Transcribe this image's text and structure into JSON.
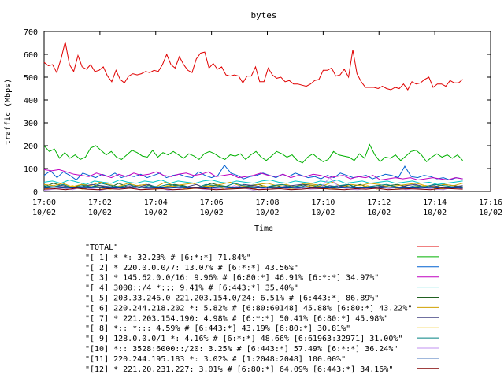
{
  "chart_data": {
    "type": "line",
    "title": "bytes",
    "xlabel": "Time",
    "ylabel": "traffic (Mbps)",
    "ylim": [
      0,
      700
    ],
    "yticks": [
      0,
      100,
      200,
      300,
      400,
      500,
      600,
      700
    ],
    "xlim": [
      "17:00",
      "17:16"
    ],
    "xticks": [
      {
        "time": "17:00",
        "date": "10/02"
      },
      {
        "time": "17:02",
        "date": "10/02"
      },
      {
        "time": "17:04",
        "date": "10/02"
      },
      {
        "time": "17:06",
        "date": "10/02"
      },
      {
        "time": "17:08",
        "date": "10/02"
      },
      {
        "time": "17:10",
        "date": "10/02"
      },
      {
        "time": "17:12",
        "date": "10/02"
      },
      {
        "time": "17:14",
        "date": "10/02"
      },
      {
        "time": "17:16",
        "date": "10/02"
      }
    ],
    "grid": false,
    "legend_position": "bottom",
    "x_minutes": [
      0.0,
      0.25,
      0.5,
      0.75,
      1.0,
      1.25,
      1.5,
      1.75,
      2.0,
      2.25,
      2.5,
      2.75,
      3.0,
      3.25,
      3.5,
      3.75,
      4.0,
      4.25,
      4.5,
      4.75,
      5.0,
      5.25,
      5.5,
      5.75,
      6.0,
      6.25,
      6.5,
      6.75,
      7.0,
      7.25,
      7.5,
      7.75,
      8.0,
      8.25,
      8.5,
      8.75,
      9.0,
      9.25,
      9.5,
      9.75,
      10.0,
      10.25,
      10.5,
      10.75,
      11.0,
      11.25,
      11.5,
      11.75,
      12.0,
      12.25,
      12.5,
      12.75,
      13.0,
      13.25,
      13.5,
      13.75,
      14.0,
      14.25,
      14.5,
      14.75,
      15.0
    ],
    "series": [
      {
        "name": "\"TOTAL\"",
        "color": "#e00000",
        "values": [
          565,
          550,
          555,
          520,
          580,
          655,
          555,
          525,
          595,
          545,
          535,
          555,
          525,
          530,
          545,
          505,
          480,
          530,
          490,
          475,
          505,
          515,
          510,
          515,
          525,
          520,
          530,
          525,
          555,
          600,
          555,
          540,
          590,
          555,
          530,
          520,
          580,
          605,
          610,
          540,
          560,
          535,
          545,
          510,
          505,
          510,
          505,
          475,
          505,
          505,
          545,
          480,
          480,
          540,
          510,
          495,
          500,
          480,
          485,
          470,
          470,
          465,
          460,
          470,
          485,
          490,
          530,
          530,
          540,
          505,
          510,
          535,
          500,
          620,
          515,
          480,
          455,
          455,
          455,
          450,
          460,
          450,
          445,
          455,
          450,
          470,
          445,
          480,
          470,
          475,
          490,
          500,
          455,
          470,
          470,
          460,
          485,
          475,
          475,
          490
        ]
      },
      {
        "name": "\"[ 1] * *: 32.23% # [6:*:*] 71.84%\"",
        "color": "#00b000",
        "values": [
          200,
          175,
          185,
          145,
          170,
          145,
          160,
          140,
          150,
          190,
          200,
          180,
          160,
          175,
          150,
          140,
          160,
          180,
          170,
          155,
          150,
          180,
          150,
          170,
          160,
          175,
          160,
          145,
          165,
          155,
          140,
          165,
          175,
          165,
          150,
          140,
          160,
          155,
          165,
          140,
          160,
          175,
          150,
          135,
          155,
          175,
          165,
          150,
          160,
          135,
          125,
          150,
          165,
          145,
          130,
          140,
          175,
          160,
          155,
          150,
          135,
          165,
          145,
          205,
          160,
          130,
          150,
          145,
          160,
          135,
          155,
          175,
          180,
          160,
          130,
          150,
          165,
          150,
          160,
          145,
          160,
          135
        ]
      },
      {
        "name": "\"[ 2] * 220.0.0.0/7: 13.07% # [6:*:*] 43.56%\"",
        "color": "#0060d0",
        "values": [
          70,
          90,
          60,
          85,
          70,
          50,
          80,
          70,
          60,
          75,
          65,
          80,
          60,
          70,
          65,
          75,
          60,
          70,
          80,
          60,
          70,
          75,
          65,
          60,
          85,
          70,
          60,
          70,
          115,
          80,
          70,
          55,
          65,
          70,
          80,
          70,
          60,
          75,
          65,
          80,
          70,
          60,
          65,
          55,
          70,
          60,
          80,
          70,
          60,
          65,
          70,
          55,
          65,
          75,
          70,
          60,
          110,
          65,
          60,
          70,
          65,
          55,
          60,
          50,
          60,
          55
        ]
      },
      {
        "name": "\"[ 3] * 145.62.0.0/16: 9.96% # [6:80:*] 46.91% [6:*:*] 34.97%\"",
        "color": "#c000c0",
        "values": [
          95,
          90,
          95,
          85,
          75,
          70,
          65,
          80,
          70,
          60,
          75,
          65,
          80,
          70,
          75,
          85,
          70,
          65,
          75,
          80,
          70,
          75,
          85,
          65,
          70,
          75,
          60,
          65,
          70,
          80,
          70,
          65,
          75,
          60,
          70,
          65,
          75,
          70,
          60,
          65,
          70,
          55,
          65,
          60,
          70,
          50,
          55,
          60,
          55,
          60,
          50,
          55,
          60,
          55,
          50,
          60,
          55
        ]
      },
      {
        "name": "\"[ 4] 3000::/4 *::: 9.41% # [6:443:*] 35.40%\"",
        "color": "#00c8c8",
        "values": [
          40,
          45,
          35,
          50,
          40,
          30,
          45,
          40,
          35,
          50,
          40,
          35,
          45,
          40,
          50,
          35,
          45,
          40,
          35,
          45,
          50,
          40,
          35,
          45,
          40,
          35,
          45,
          50,
          40,
          35,
          45,
          40,
          35,
          45,
          40,
          50,
          35,
          40,
          45,
          35,
          40,
          45,
          35,
          40,
          45,
          35,
          40,
          30,
          35,
          40,
          45
        ]
      },
      {
        "name": "\"[ 5] 203.33.246.0 221.203.154.0/24: 6.51% # [6:443:*] 86.89%\"",
        "color": "#206020",
        "values": [
          20,
          35,
          25,
          15,
          30,
          20,
          25,
          15,
          35,
          20,
          25,
          30,
          15,
          20,
          30,
          25,
          15,
          20,
          35,
          25,
          20,
          15,
          25,
          30,
          20,
          25,
          15,
          20,
          30,
          25,
          20,
          15,
          25,
          20,
          30,
          15,
          20,
          25,
          30,
          20,
          15,
          25,
          20,
          30,
          25,
          20
        ]
      },
      {
        "name": "\"[ 6] 220.244.218.202 *: 5.82% # [6:80:60148] 45.88% [6:80:*] 43.22%\"",
        "color": "#d0a000",
        "values": [
          30,
          25,
          35,
          20,
          30,
          25,
          40,
          30,
          20,
          35,
          25,
          30,
          20,
          40,
          25,
          30,
          35,
          20,
          25,
          30,
          40,
          25,
          20,
          30,
          35,
          25,
          30,
          20,
          35,
          30,
          25,
          40,
          20,
          30,
          25,
          35,
          30,
          20,
          25,
          30,
          35,
          25,
          20,
          30,
          25,
          35
        ]
      },
      {
        "name": "\"[ 7] * 221.203.154.190: 4.98% # [6:*:*] 50.41% [6:80:*] 45.98%\"",
        "color": "#404080",
        "values": [
          15,
          20,
          25,
          15,
          20,
          30,
          25,
          20,
          15,
          25,
          20,
          30,
          15,
          20,
          25,
          20,
          30,
          15,
          25,
          20,
          15,
          30,
          25,
          20,
          15,
          20,
          25,
          30,
          20,
          15,
          25,
          20,
          30,
          15,
          20,
          25,
          20,
          15,
          25,
          30,
          20,
          25,
          15,
          20,
          25
        ]
      },
      {
        "name": "\"[ 8] *:: *::: 4.59% # [6:443:*] 43.19% [6:80:*] 30.81%\"",
        "color": "#f0c000",
        "values": [
          10,
          20,
          15,
          25,
          10,
          20,
          15,
          10,
          25,
          15,
          20,
          10,
          15,
          25,
          20,
          10,
          15,
          20,
          25,
          10,
          15,
          20,
          10,
          25,
          15,
          20,
          10,
          15,
          25,
          20,
          10,
          15,
          20,
          15,
          25,
          10,
          20,
          15,
          10,
          20,
          25,
          15,
          10,
          20,
          15
        ]
      },
      {
        "name": "\"[ 9] 128.0.0.0/1 *: 4.16% # [6:*:*] 48.66% [6:61963:32971] 31.00%\"",
        "color": "#008080",
        "values": [
          25,
          20,
          30,
          15,
          25,
          20,
          35,
          25,
          20,
          30,
          15,
          25,
          20,
          30,
          25,
          20,
          15,
          30,
          25,
          20,
          35,
          25,
          20,
          15,
          25,
          30,
          20,
          25,
          15,
          30,
          20,
          25,
          30,
          15,
          20,
          25,
          30,
          20,
          15,
          25,
          20,
          30,
          25,
          20,
          15
        ]
      },
      {
        "name": "\"[10] *:: 3528:6000::/20: 3.25% # [6:443:*] 57.49% [6:*:*] 36.24%\"",
        "color": "#c090f0",
        "values": [
          5,
          10,
          15,
          8,
          20,
          12,
          6,
          15,
          10,
          25,
          8,
          12,
          18,
          6,
          10,
          20,
          15,
          8,
          12,
          10,
          25,
          15,
          6,
          12,
          10,
          18,
          8,
          15,
          10,
          12,
          60,
          20,
          10,
          8,
          15,
          12,
          10,
          18,
          8,
          12,
          15,
          10,
          8,
          20,
          12
        ]
      },
      {
        "name": "\"[11] 220.244.195.183 *: 3.02% # [1:2048:2048] 100.00%\"",
        "color": "#0040a0",
        "values": [
          15,
          18,
          15,
          16,
          15,
          17,
          15,
          16,
          15,
          18,
          15,
          16,
          15,
          17,
          15,
          16,
          15,
          18,
          15,
          16,
          15,
          17,
          15,
          16,
          15,
          18,
          15,
          16,
          15,
          17,
          15,
          16,
          15,
          18,
          15,
          16,
          15,
          17,
          15,
          16,
          15
        ]
      },
      {
        "name": "\"[12] * 221.20.231.227: 3.01% # [6:80:*] 64.09% [6:443:*] 34.16%\"",
        "color": "#800000",
        "values": [
          10,
          12,
          8,
          14,
          10,
          8,
          12,
          10,
          14,
          8,
          10,
          12,
          8,
          10,
          14,
          12,
          8,
          10,
          12,
          14,
          8,
          10,
          12,
          8,
          10,
          14,
          12,
          10,
          8,
          12,
          10,
          14,
          8,
          10,
          12,
          10,
          8,
          14,
          12,
          10
        ]
      }
    ]
  }
}
